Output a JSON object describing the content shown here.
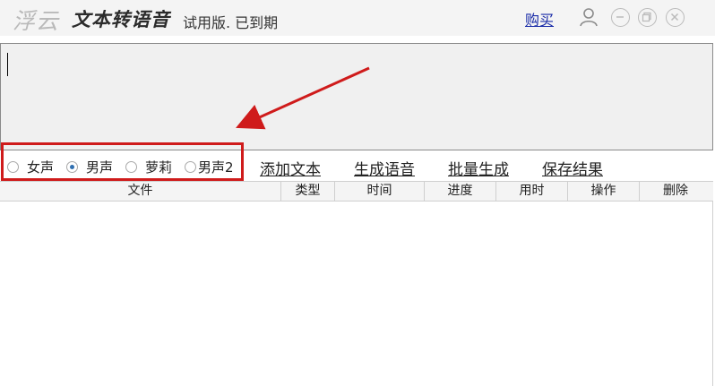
{
  "titlebar": {
    "logo_text": "浮云",
    "app_title": "文本转语音",
    "trial_status": "试用版. 已到期",
    "buy_link": "购买",
    "icons": [
      "user-icon",
      "minimize-icon",
      "restore-icon",
      "close-icon"
    ]
  },
  "voices": [
    {
      "label": "女声",
      "selected": false
    },
    {
      "label": "男声",
      "selected": true
    },
    {
      "label": "萝莉",
      "selected": false
    },
    {
      "label": "男声2",
      "selected": false
    }
  ],
  "actions": {
    "add_text": "添加文本",
    "generate_speech": "生成语音",
    "batch_generate": "批量生成",
    "save_result": "保存结果"
  },
  "table": {
    "columns": [
      "文件",
      "类型",
      "时间",
      "进度",
      "用时",
      "操作",
      "删除"
    ],
    "rows": []
  },
  "colors": {
    "highlight_box": "#cf1b1b",
    "annotation_arrow": "#cf1b1b",
    "link": "#1a2ca8",
    "radio_selected": "#2f6fb0"
  }
}
